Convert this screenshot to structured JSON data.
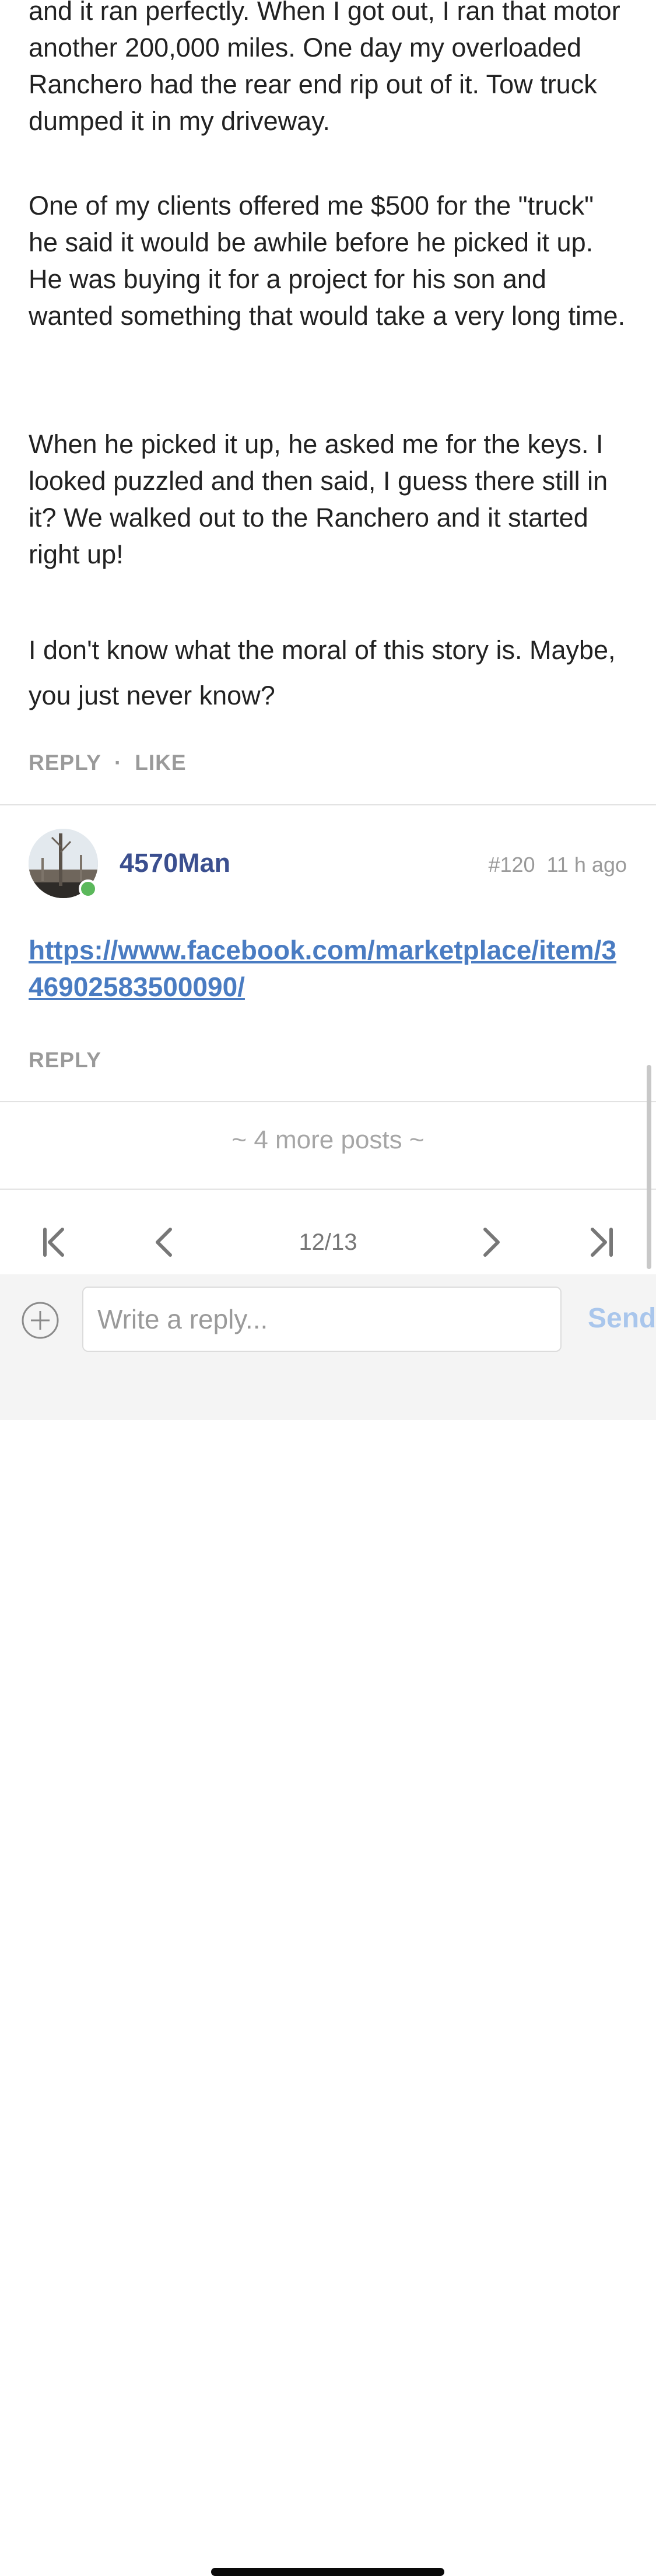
{
  "post_body": {
    "paragraphs": [
      "and it ran perfectly. When I got out, I ran that motor another 200,000 miles. One day my overloaded Ranchero had the rear end rip out of it. Tow truck dumped it in my driveway.",
      "One of my clients offered me $500 for the \"truck\" he said it would be awhile before he picked it up. He was buying it for a project for his son and wanted something that would take a very long time.",
      "When he picked it up, he asked me for the keys. I looked puzzled and then said, I guess there still in it? We walked out to the Ranchero and it started right up!",
      "I don't know what the moral of this story is. Maybe, you just never know?"
    ],
    "actions": {
      "reply": "REPLY",
      "separator": "·",
      "like": "LIKE"
    }
  },
  "next_post": {
    "username": "4570Man",
    "post_number": "#120",
    "time_ago": "11 h ago",
    "link_text": "https://www.facebook.com/marketplace/item/346902583500090/",
    "reply": "REPLY",
    "online": true
  },
  "more_posts": "~ 4 more posts ~",
  "pager": {
    "page": "12/13"
  },
  "composer": {
    "placeholder": "Write a reply...",
    "send": "Send"
  },
  "colors": {
    "username": "#3b4f8f",
    "link": "#4a7cc2",
    "online": "#5bb85b",
    "send": "#a9c6ec"
  },
  "icons": [
    "first-page-icon",
    "prev-page-icon",
    "next-page-icon",
    "last-page-icon",
    "plus-circle-icon"
  ]
}
